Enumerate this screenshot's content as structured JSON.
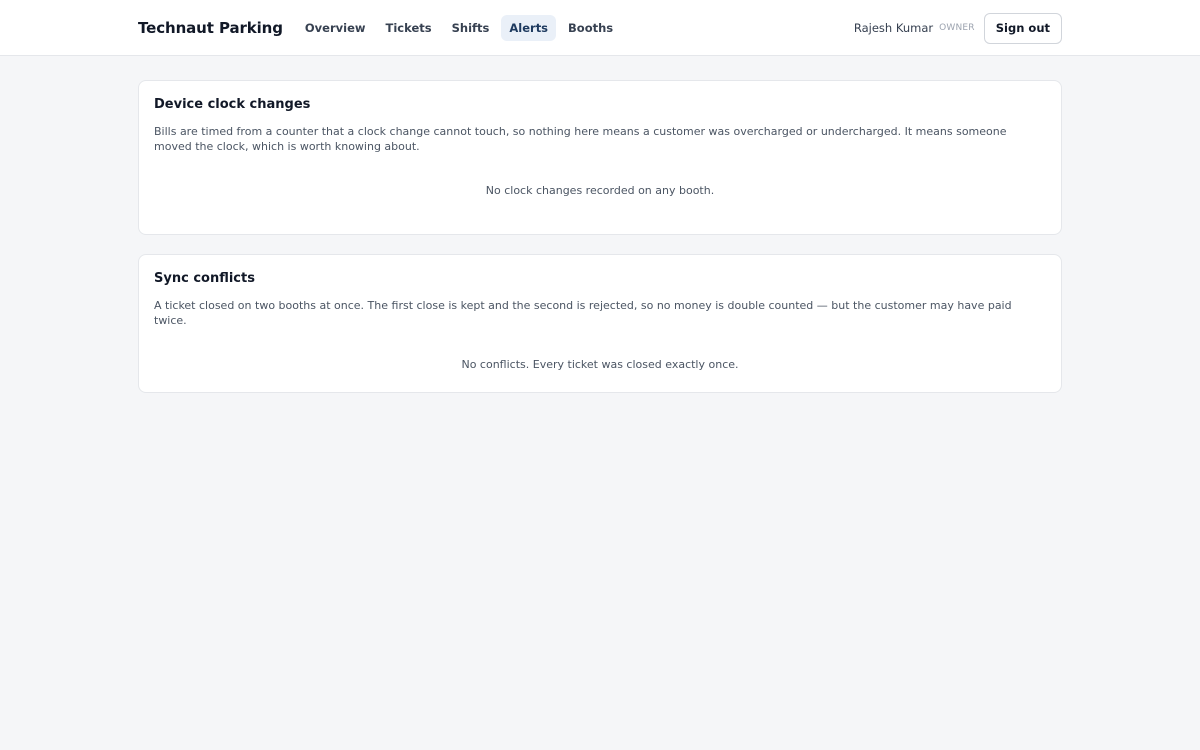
{
  "header": {
    "brand": "Technaut Parking",
    "nav": [
      {
        "label": "Overview"
      },
      {
        "label": "Tickets"
      },
      {
        "label": "Shifts"
      },
      {
        "label": "Alerts",
        "active": true
      },
      {
        "label": "Booths"
      }
    ],
    "user_name": "Rajesh Kumar",
    "user_role": "OWNER",
    "sign_out_label": "Sign out"
  },
  "cards": {
    "clock": {
      "title": "Device clock changes",
      "description": "Bills are timed from a counter that a clock change cannot touch, so nothing here means a customer was overcharged or undercharged. It means someone moved the clock, which is worth knowing about.",
      "empty_message": "No clock changes recorded on any booth."
    },
    "sync": {
      "title": "Sync conflicts",
      "description": "A ticket closed on two booths at once. The first close is kept and the second is rejected, so no money is double counted — but the customer may have paid twice.",
      "empty_message": "No conflicts. Every ticket was closed exactly once."
    }
  },
  "colors": {
    "page_background": "#f5f6f8",
    "active_nav_background": "#eaf0f8",
    "active_nav_text": "#1e3a5f"
  }
}
